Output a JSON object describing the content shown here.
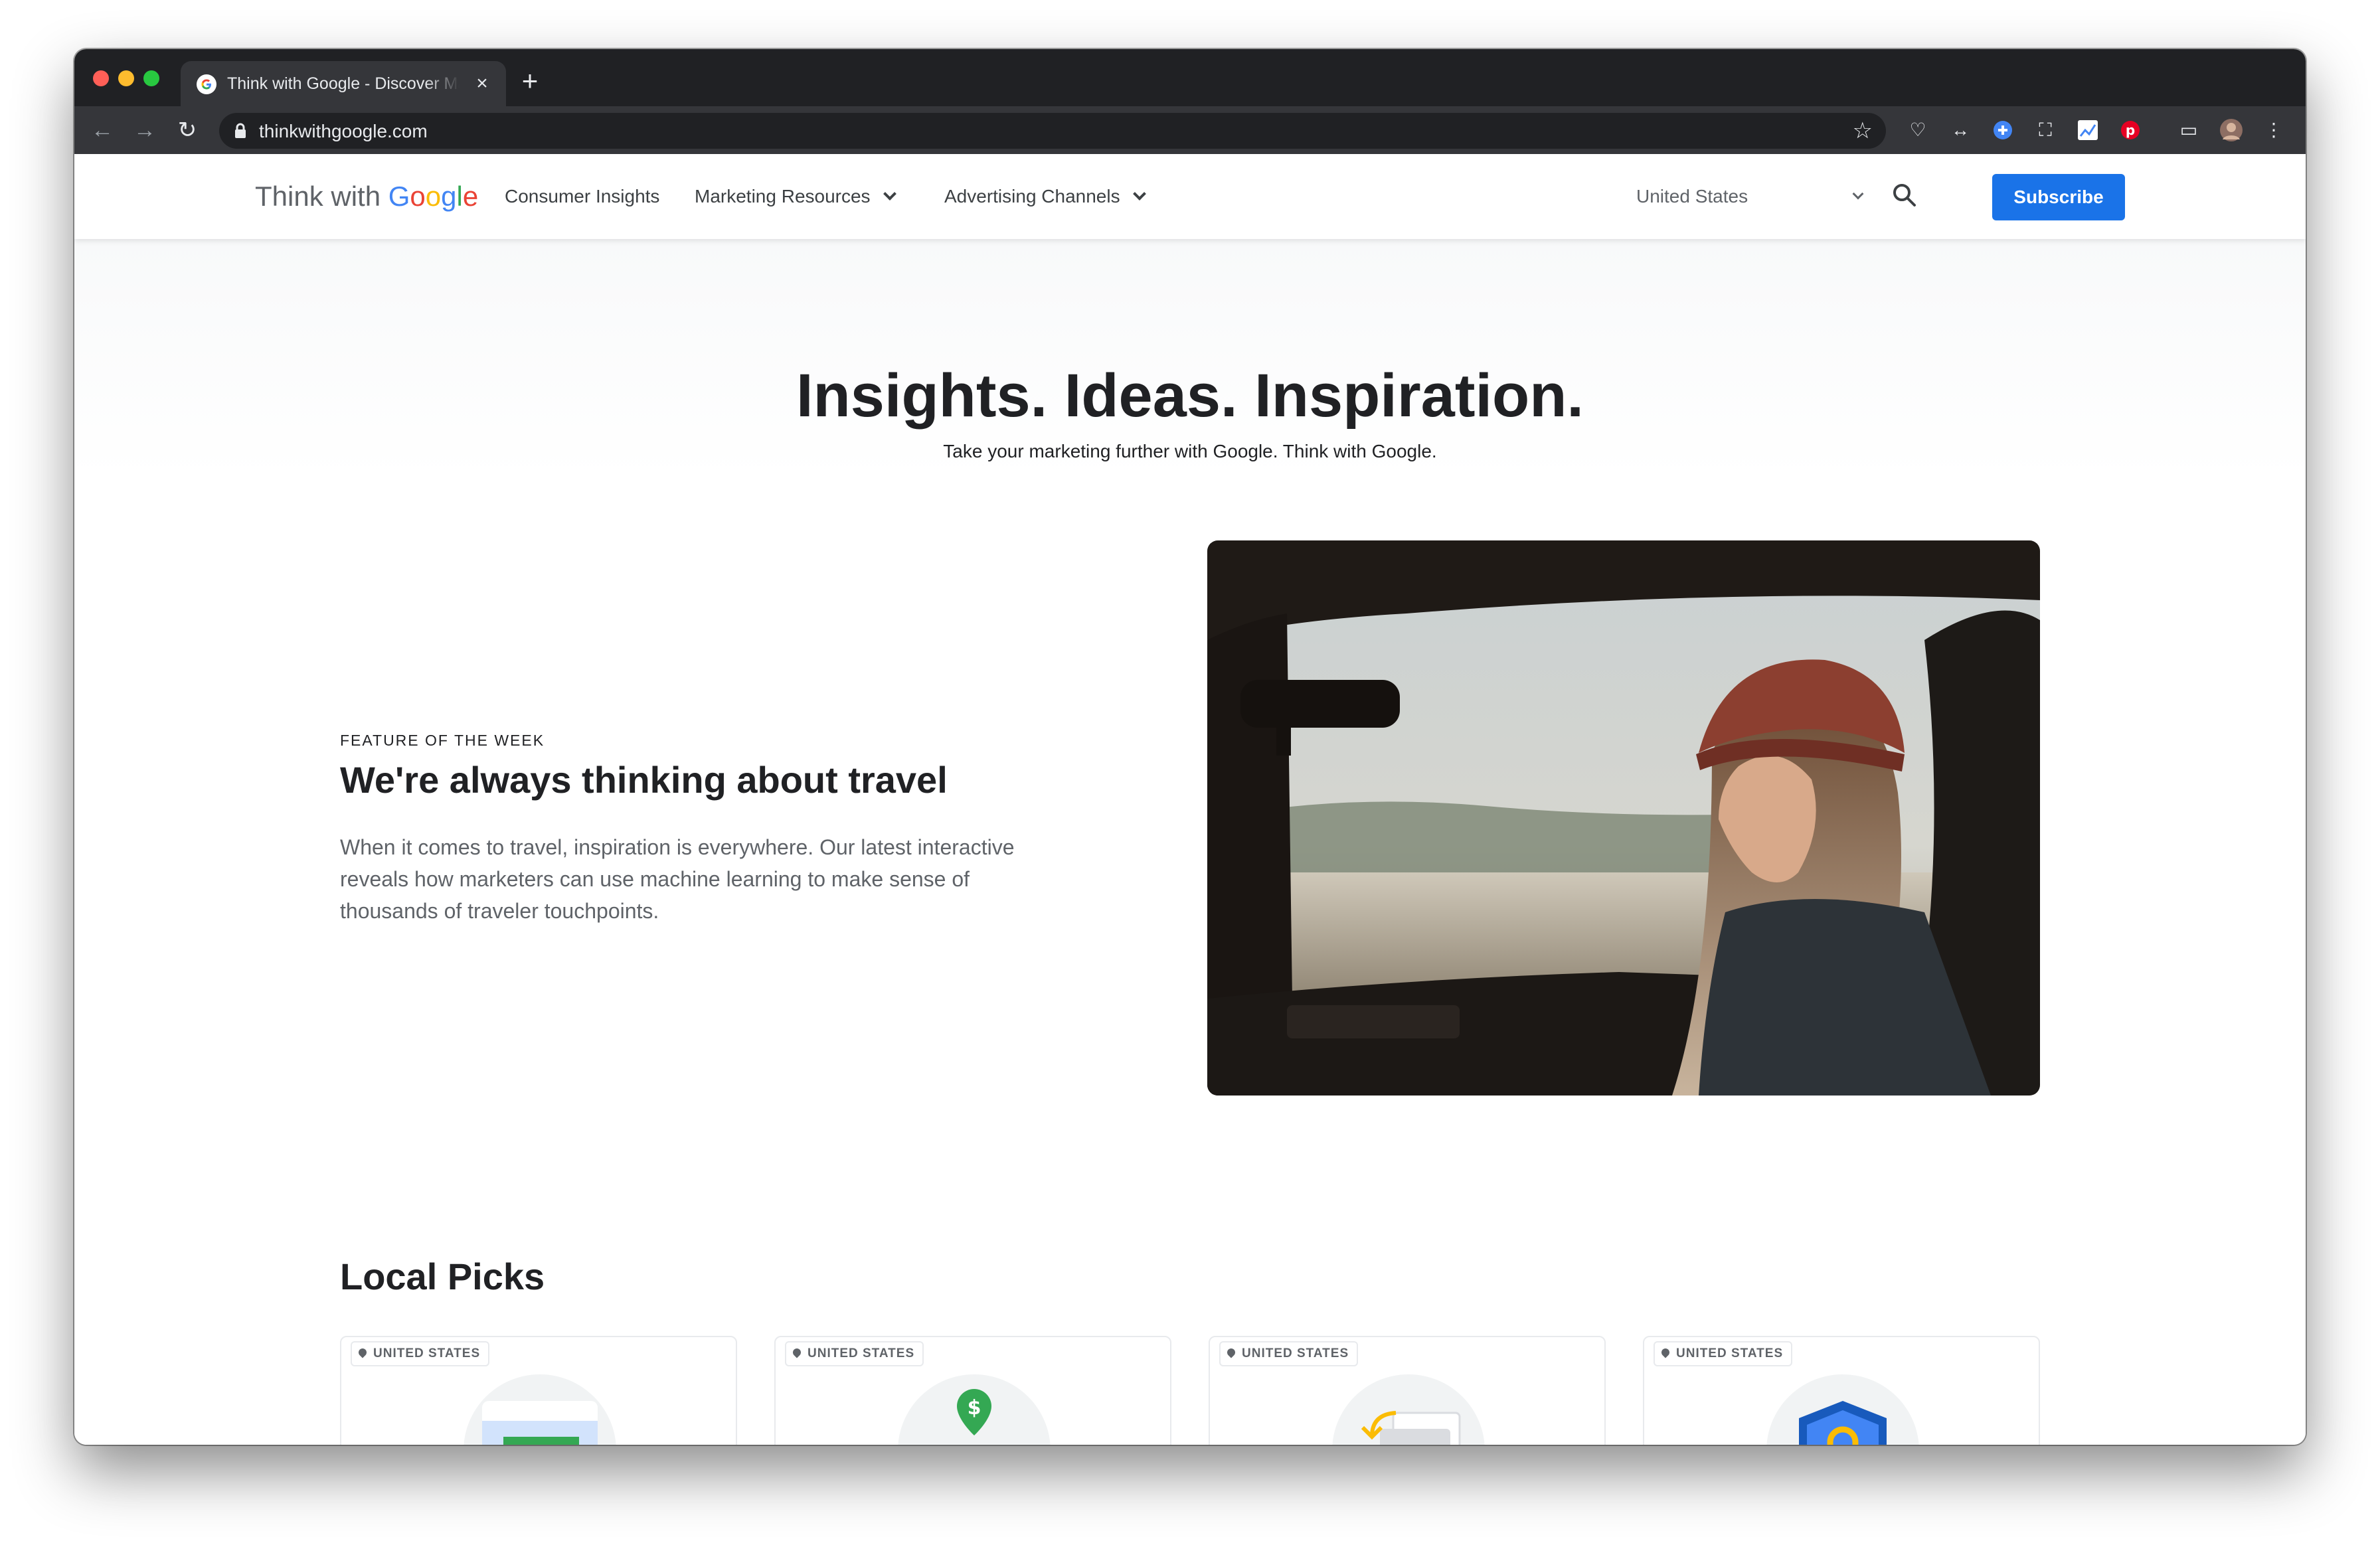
{
  "browser": {
    "tab_title": "Think with Google - Discover Marketing Research & Digital Trends",
    "tab_close": "×",
    "new_tab": "+",
    "url": "thinkwithgoogle.com"
  },
  "header": {
    "logo_prefix": "Think with ",
    "logo_letters": [
      "G",
      "o",
      "o",
      "g",
      "l",
      "e"
    ],
    "nav": [
      {
        "label": "Consumer Insights"
      },
      {
        "label": "Marketing Resources"
      },
      {
        "label": "Advertising Channels"
      }
    ],
    "region": "United States",
    "subscribe_label": "Subscribe"
  },
  "hero": {
    "headline": "Insights. Ideas. Inspiration.",
    "subline": "Take your marketing further with Google. Think with Google."
  },
  "feature": {
    "eyebrow": "FEATURE OF THE WEEK",
    "title": "We're always thinking about travel",
    "description": "When it comes to travel, inspiration is everywhere. Our latest interactive reveals how marketers can use machine learning to make sense of thousands of traveler touchpoints."
  },
  "local_picks": {
    "title": "Local Picks",
    "cards": [
      {
        "tag": "UNITED STATES",
        "icon": "storefront-icon"
      },
      {
        "tag": "UNITED STATES",
        "icon": "house-dollar-icon"
      },
      {
        "tag": "UNITED STATES",
        "icon": "card-exchange-icon"
      },
      {
        "tag": "UNITED STATES",
        "icon": "shield-lock-icon"
      }
    ]
  },
  "colors": {
    "brand_blue": "#1a73e8",
    "google_blue": "#4285f4",
    "google_red": "#ea4335",
    "google_yellow": "#fbbc05",
    "google_green": "#34a853"
  }
}
